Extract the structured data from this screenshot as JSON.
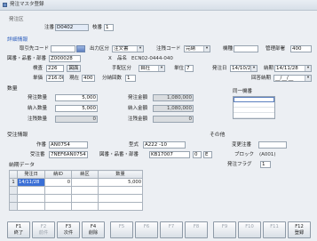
{
  "window": {
    "title": "発注マスタ登録",
    "icon": "form-icon"
  },
  "header": {
    "group_label": "発注区",
    "order_no_label": "注番",
    "order_no": "D0402",
    "branch_label": "枝番",
    "branch": "1"
  },
  "detail": {
    "title": "詳細情報",
    "supplier_code": {
      "label": "取引先コード",
      "value": ""
    },
    "output_type": {
      "label": "出力区分",
      "value": "注文書"
    },
    "remain_code": {
      "label": "注残コード",
      "value": "完納"
    },
    "model": {
      "label": "機種",
      "value": ""
    },
    "dept": {
      "label": "管理部署",
      "value": "400"
    },
    "drawing": {
      "label": "図番・品番・部番",
      "value": "Z000028"
    },
    "x_mark": "X",
    "item_name": {
      "label": "品名",
      "value": "ECN02-0444-040"
    },
    "inspection": {
      "label": "検査",
      "value": "226"
    },
    "drawing_button": "図面",
    "arrange_type": {
      "label": "手配区分",
      "value": "自社"
    },
    "unit": {
      "label": "単位",
      "value": "7"
    },
    "order_date": {
      "label": "発注日",
      "value": "14/10/21"
    },
    "due_date": {
      "label": "納期",
      "value": "14/11/28"
    },
    "unit_price": {
      "label": "単価",
      "value": "216.00"
    },
    "current": {
      "label": "現在",
      "value": "400"
    },
    "split_count": {
      "label": "分納回数",
      "value": "1"
    },
    "reply_due": {
      "label": "回答納期",
      "value": "__/__/__"
    }
  },
  "quantity": {
    "title": "数量",
    "rows": [
      {
        "qty_label": "発注数量",
        "qty": "5,000",
        "amt_label": "発注金額",
        "amt": "1,080,000"
      },
      {
        "qty_label": "納入数量",
        "qty": "5,000",
        "amt_label": "納入金額",
        "amt": "1,080,000"
      },
      {
        "qty_label": "注残数量",
        "qty": "0",
        "amt_label": "注残金額",
        "amt": "0"
      }
    ]
  },
  "same_machine": {
    "title": "同一機番",
    "rows": [
      "",
      "",
      "",
      ""
    ]
  },
  "order_info": {
    "title": "受注情報",
    "work_no": {
      "label": "作番",
      "value": "AN0754"
    },
    "model_type": {
      "label": "型式",
      "value": "A222 -10"
    },
    "order_no": {
      "label": "受注番",
      "value": "7NEF6AN0754"
    },
    "drawing": {
      "label": "図番・品番・部番",
      "value": "KB17007",
      "rev": "0",
      "suffix": "E"
    }
  },
  "other": {
    "title": "その他",
    "change_no": {
      "label": "変更注番",
      "value": ""
    },
    "block": {
      "label": "ブロック",
      "value": "(A001)"
    },
    "order_flag": {
      "label": "発注フラグ",
      "value": "1"
    }
  },
  "delivery": {
    "title": "納期データ",
    "columns": [
      "発注日",
      "納ID",
      "納区",
      "数量"
    ],
    "rows": [
      {
        "no": "1",
        "date": "14/11/28",
        "id": "0",
        "kind": "",
        "qty": "5,000"
      },
      {
        "no": "",
        "date": "",
        "id": "",
        "kind": "",
        "qty": ""
      },
      {
        "no": "",
        "date": "",
        "id": "",
        "kind": "",
        "qty": ""
      },
      {
        "no": "",
        "date": "",
        "id": "",
        "kind": "",
        "qty": ""
      }
    ]
  },
  "function_keys": [
    {
      "key": "F1",
      "label": "終了"
    },
    {
      "key": "F2",
      "label": "前件"
    },
    {
      "key": "F3",
      "label": "次件"
    },
    {
      "key": "F4",
      "label": "削除"
    },
    {
      "key": "F5",
      "label": ""
    },
    {
      "key": "F6",
      "label": ""
    },
    {
      "key": "F7",
      "label": ""
    },
    {
      "key": "F8",
      "label": ""
    },
    {
      "key": "F9",
      "label": ""
    },
    {
      "key": "F10",
      "label": ""
    },
    {
      "key": "F11",
      "label": ""
    },
    {
      "key": "F12",
      "label": "登録"
    }
  ]
}
